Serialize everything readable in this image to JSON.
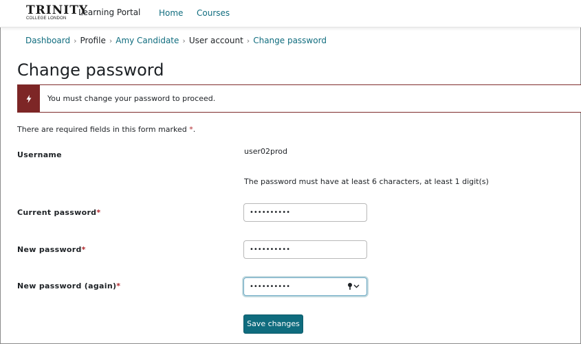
{
  "header": {
    "logo_main": "TRINITY",
    "logo_sub": "COLLEGE LONDON",
    "brand": "Learning Portal",
    "nav": [
      {
        "label": "Home"
      },
      {
        "label": "Courses"
      }
    ]
  },
  "breadcrumb": {
    "items": [
      {
        "label": "Dashboard",
        "link": true
      },
      {
        "label": "Profile",
        "link": false
      },
      {
        "label": "Amy Candidate",
        "link": true
      },
      {
        "label": "User account",
        "link": false
      },
      {
        "label": "Change password",
        "link": true
      }
    ],
    "separator": "›"
  },
  "page": {
    "title": "Change password"
  },
  "alert": {
    "icon": "bolt-icon",
    "message": "You must change your password to proceed.",
    "color": "#7d2626"
  },
  "form": {
    "required_note_prefix": "There are required fields in this form marked",
    "required_marker": "*",
    "required_note_suffix": ".",
    "username_label": "Username",
    "username_value": "user02prod",
    "password_rule": "The password must have at least 6 characters, at least 1 digit(s)",
    "current_password_label": "Current password",
    "current_password_value": "••••••••••",
    "new_password_label": "New password",
    "new_password_value": "••••••••••",
    "new_password_again_label": "New password (again)",
    "new_password_again_value": "••••••••••",
    "password_manager_icon": "key-dropdown-icon",
    "submit_label": "Save changes"
  },
  "colors": {
    "accent": "#0f6c7e",
    "required": "#b1272c"
  }
}
